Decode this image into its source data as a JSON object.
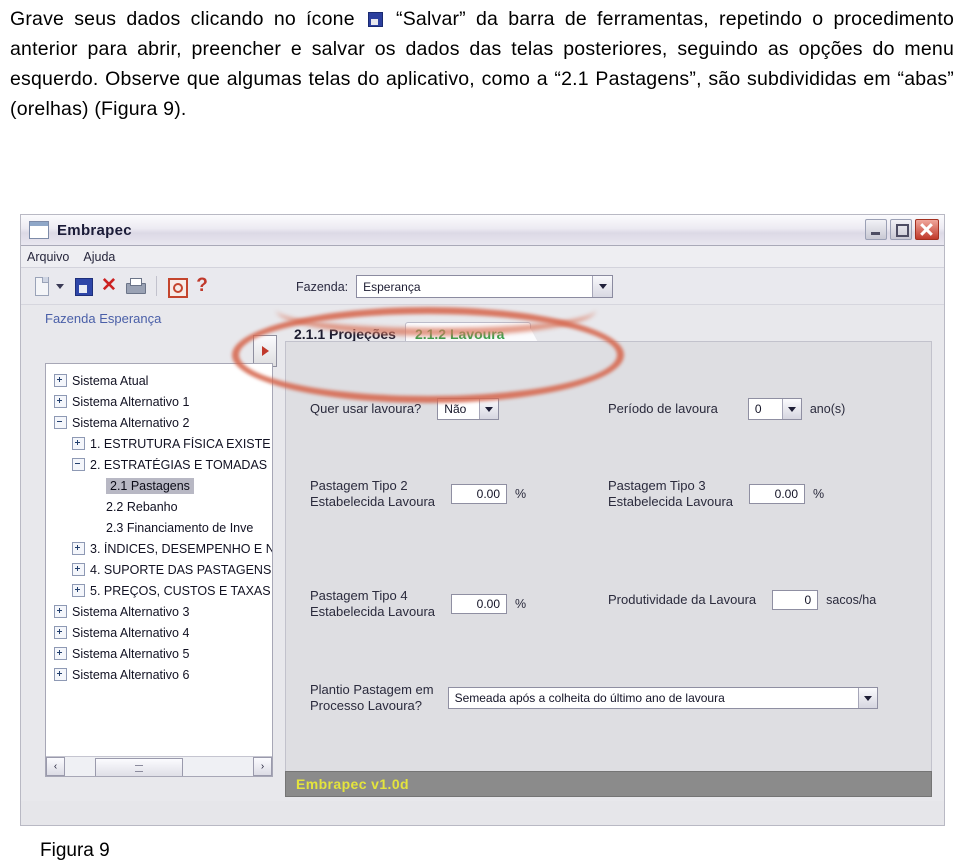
{
  "document": {
    "paragraph_part1": "Grave seus dados clicando no ícone ",
    "paragraph_part2": " “Salvar” da barra de ferramentas, repetindo o procedimento anterior para abrir, preencher e salvar os dados das telas posteriores, seguindo as opções do menu esquerdo. Observe que algumas telas do aplicativo, como a “2.1 Pastagens”, são subdivididas em “abas” (orelhas) (Figura 9).",
    "figure_caption": "Figura 9"
  },
  "window": {
    "title": "Embrapec",
    "icon": "window-icon",
    "controls": {
      "minimize": "minimize-button",
      "restore": "restore-button",
      "close": "close-button"
    }
  },
  "menubar": {
    "items": [
      {
        "label": "Arquivo"
      },
      {
        "label": "Ajuda"
      }
    ]
  },
  "toolbar": {
    "icons": [
      {
        "name": "new-document-icon"
      },
      {
        "name": "dropdown-caret-icon"
      },
      {
        "name": "save-icon"
      },
      {
        "name": "delete-icon",
        "glyph": "✕"
      },
      {
        "name": "print-icon"
      },
      {
        "name": "report-icon"
      },
      {
        "name": "help-icon",
        "glyph": "?"
      }
    ],
    "fazenda": {
      "label": "Fazenda:",
      "value": "Esperança"
    }
  },
  "sidebar": {
    "header": "Fazenda Esperança",
    "splitter": "collapse-arrow",
    "tree": [
      {
        "label": "Sistema Atual",
        "indent": 1,
        "state": "plus",
        "selected": false
      },
      {
        "label": "Sistema Alternativo 1",
        "indent": 1,
        "state": "plus",
        "selected": false
      },
      {
        "label": "Sistema Alternativo 2",
        "indent": 1,
        "state": "minus",
        "selected": false
      },
      {
        "label": "1. ESTRUTURA FÍSICA EXISTE",
        "indent": 2,
        "state": "plus",
        "selected": false
      },
      {
        "label": "2. ESTRATÉGIAS E TOMADAS",
        "indent": 2,
        "state": "minus",
        "selected": false
      },
      {
        "label": "2.1 Pastagens",
        "indent": 3,
        "state": "leaf",
        "selected": true
      },
      {
        "label": "2.2 Rebanho",
        "indent": 3,
        "state": "leaf",
        "selected": false
      },
      {
        "label": "2.3 Financiamento de Inve",
        "indent": 3,
        "state": "leaf",
        "selected": false
      },
      {
        "label": "3. ÍNDICES, DESEMPENHO E N",
        "indent": 2,
        "state": "plus",
        "selected": false
      },
      {
        "label": "4. SUPORTE DAS PASTAGENS",
        "indent": 2,
        "state": "plus",
        "selected": false
      },
      {
        "label": "5. PREÇOS, CUSTOS E TAXAS",
        "indent": 2,
        "state": "plus",
        "selected": false
      },
      {
        "label": "Sistema Alternativo 3",
        "indent": 1,
        "state": "plus",
        "selected": false
      },
      {
        "label": "Sistema Alternativo 4",
        "indent": 1,
        "state": "plus",
        "selected": false
      },
      {
        "label": "Sistema Alternativo 5",
        "indent": 1,
        "state": "plus",
        "selected": false
      },
      {
        "label": "Sistema Alternativo 6",
        "indent": 1,
        "state": "plus",
        "selected": false
      }
    ],
    "hscroll": {
      "left_arrow": "‹",
      "right_arrow": "›"
    }
  },
  "tabs": [
    {
      "label": "2.1.1 Projeções",
      "active": false
    },
    {
      "label": "2.1.2 Lavoura",
      "active": true
    }
  ],
  "form": {
    "use_crop": {
      "label": "Quer usar lavoura?",
      "value": "Não"
    },
    "crop_period": {
      "label": "Período de lavoura",
      "value": "0",
      "unit": "ano(s)"
    },
    "pasture2": {
      "label": "Pastagem Tipo 2\nEstabelecida Lavoura",
      "value": "0.00",
      "unit": "%"
    },
    "pasture3": {
      "label": "Pastagem Tipo 3\nEstabelecida Lavoura",
      "value": "0.00",
      "unit": "%"
    },
    "pasture4": {
      "label": "Pastagem Tipo 4\nEstabelecida Lavoura",
      "value": "0.00",
      "unit": "%"
    },
    "productivity": {
      "label": "Produtividade da Lavoura",
      "value": "0",
      "unit": "sacos/ha"
    },
    "planting": {
      "label": "Plantio Pastagem em\nProcesso Lavoura?",
      "value": "Semeada após a colheita do último ano de lavoura"
    }
  },
  "statusbar": {
    "text": "Embrapec v1.0d"
  },
  "colors": {
    "accent_green": "#34a04a",
    "annotation_red": "#d6684f",
    "status_yellow": "#e4e43c",
    "header_blue": "#4a5fa8"
  }
}
